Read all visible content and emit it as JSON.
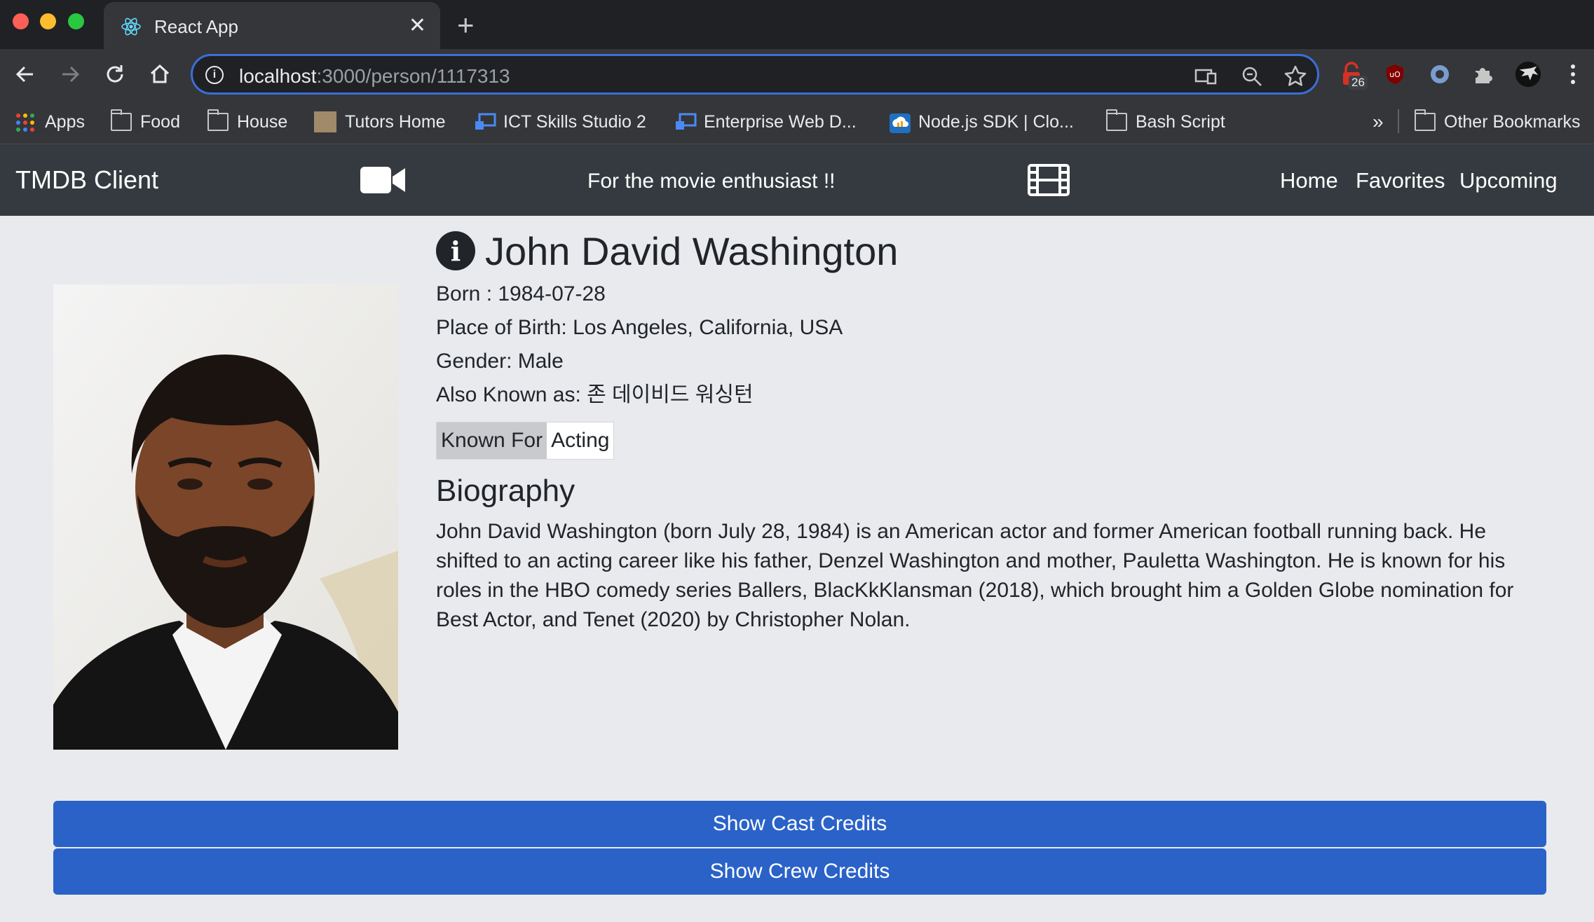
{
  "browser": {
    "tab_title": "React App",
    "url_host": "localhost",
    "url_rest": ":3000/person/1117313",
    "extension_badge": "26",
    "bookmarks": [
      "Apps",
      "Food",
      "House",
      "Tutors Home",
      "ICT Skills Studio 2",
      "Enterprise Web D...",
      "Node.js SDK | Clo...",
      "Bash Script"
    ],
    "overflow_label": "»",
    "other_bookmarks": "Other Bookmarks"
  },
  "navbar": {
    "brand": "TMDB Client",
    "tagline": "For the movie enthusiast !!",
    "links": [
      "Home",
      "Favorites",
      "Upcoming"
    ]
  },
  "person": {
    "name": "John David Washington",
    "born": "Born : 1984-07-28",
    "birthplace": "Place of Birth: Los Angeles, California, USA",
    "gender": "Gender: Male",
    "aka": "Also Known as: 존 데이비드 워싱턴",
    "known_for_label": "Known For",
    "known_for_value": "Acting",
    "bio_heading": "Biography",
    "bio": "John David Washington (born July 28, 1984) is an American actor and former American football running back. He shifted to an acting career like his father, Denzel Washington and mother, Pauletta Washington. He is known for his roles in the HBO comedy series Ballers, BlacKkKlansman (2018), which brought him a Golden Globe nomination for Best Actor, and Tenet (2020) by Christopher Nolan."
  },
  "buttons": {
    "cast": "Show Cast Credits",
    "crew": "Show Crew Credits"
  },
  "colors": {
    "navbar_bg": "#343a40",
    "page_bg": "#e9eaee",
    "button_bg": "#2a62c8"
  }
}
